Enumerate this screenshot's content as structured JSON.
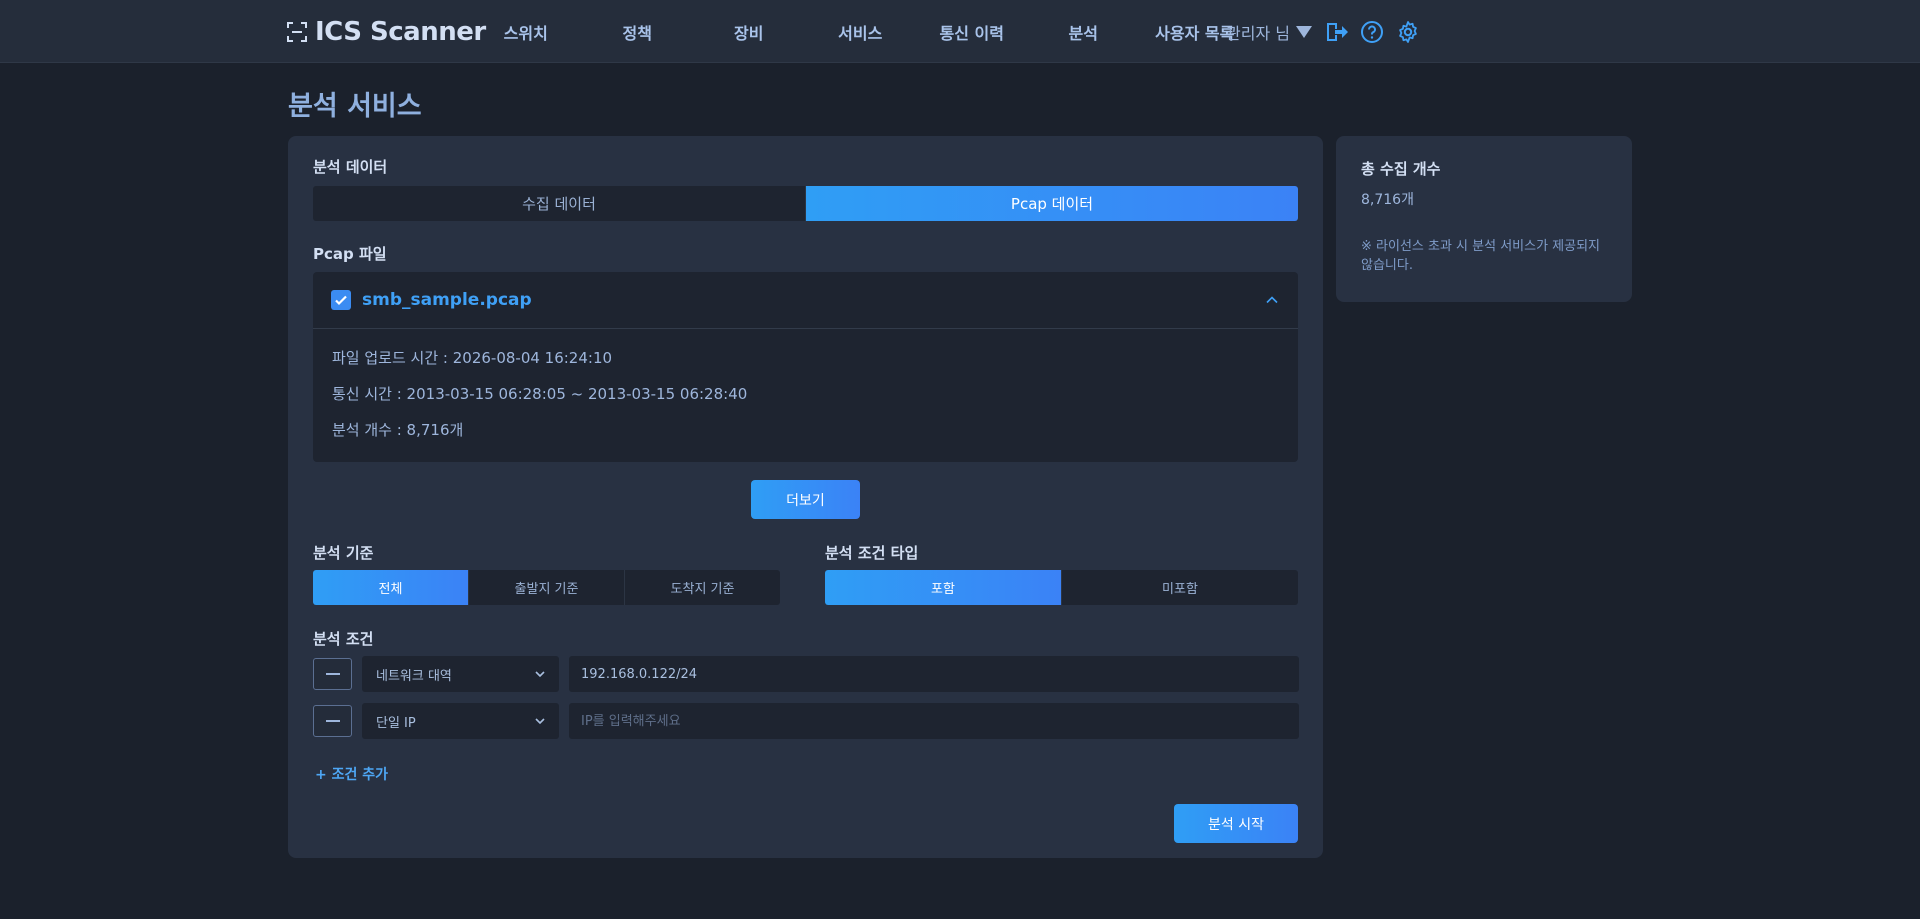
{
  "header": {
    "logo_text": "ICS Scanner",
    "nav": [
      "스위치",
      "정책",
      "장비",
      "서비스",
      "통신 이력",
      "분석",
      "사용자 목록"
    ],
    "user_name": "관리자 님"
  },
  "page_title": "분석 서비스",
  "analysis_data": {
    "label": "분석 데이터",
    "tabs": [
      "수집 데이터",
      "Pcap 데이터"
    ],
    "active_tab": 1
  },
  "pcap": {
    "label": "Pcap 파일",
    "file_name": "smb_sample.pcap",
    "checked": true,
    "upload_time": "파일 업로드 시간 : 2026-08-04 16:24:10",
    "comm_time": "통신 시간 : 2013-03-15 06:28:05 ~ 2013-03-15 06:28:40",
    "count": "분석 개수 : 8,716개",
    "more_label": "더보기"
  },
  "criteria": {
    "label": "분석 기준",
    "options": [
      "전체",
      "출발지 기준",
      "도착지 기준"
    ],
    "active": 0
  },
  "condition_type": {
    "label": "분석 조건 타입",
    "options": [
      "포함",
      "미포함"
    ],
    "active": 0
  },
  "conditions": {
    "label": "분석 조건",
    "rows": [
      {
        "type": "네트워크 대역",
        "value": "192.168.0.122/24",
        "placeholder": ""
      },
      {
        "type": "단일 IP",
        "value": "",
        "placeholder": "IP를 입력해주세요"
      }
    ],
    "add_label": "+ 조건 추가"
  },
  "start_label": "분석 시작",
  "summary": {
    "title": "총 수집 개수",
    "count": "8,716개",
    "note": "※ 라이선스 초과 시 분석 서비스가 제공되지 않습니다."
  },
  "colors": {
    "background": "#1b212c",
    "panel": "#283142",
    "accent": "#3b8cf2",
    "accent_gradient_start": "#2f9ef5"
  }
}
